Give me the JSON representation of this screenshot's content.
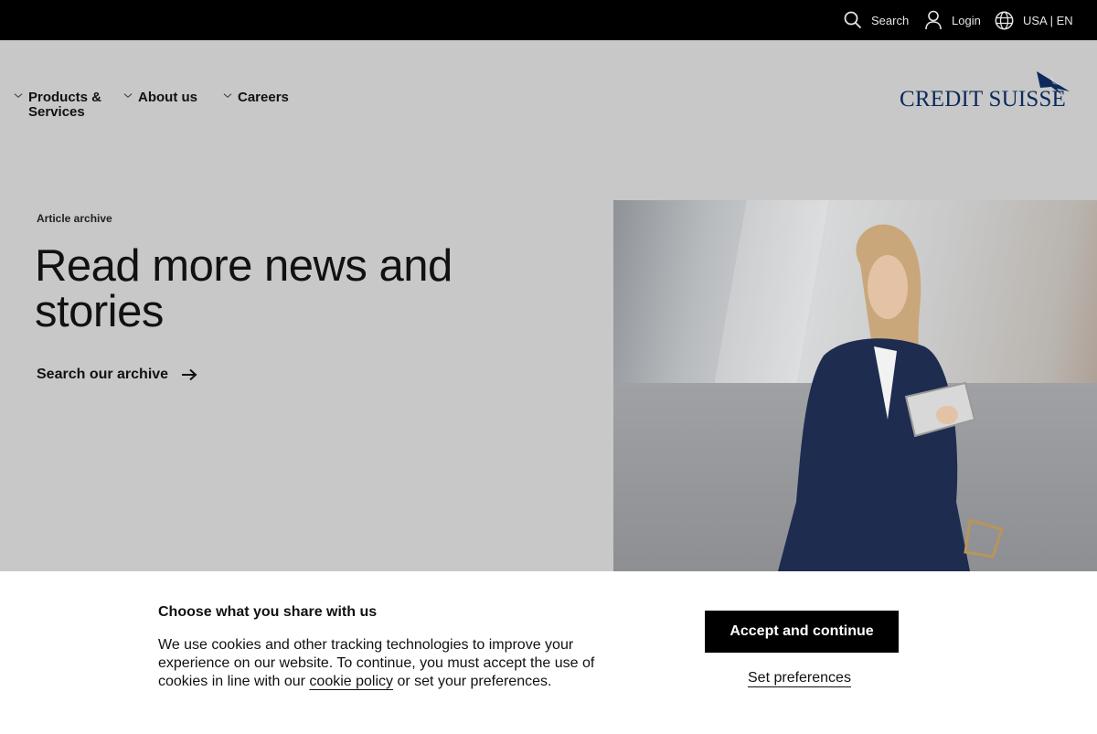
{
  "topbar": {
    "search_label": "Search",
    "login_label": "Login",
    "language_label": "USA | EN"
  },
  "nav": {
    "items": [
      {
        "label": "Products & Services"
      },
      {
        "label": "About us"
      },
      {
        "label": "Careers"
      }
    ]
  },
  "logo": {
    "text": "CREDIT SUISSE"
  },
  "hero": {
    "eyebrow": "Article archive",
    "headline": "Read more news and stories",
    "link_label": "Search our archive"
  },
  "cookie_banner": {
    "title": "Choose what you share with us",
    "text_before_link": "We use cookies and other tracking technologies to improve your experience on our website. To continue, you must accept the use of cookies in line with our ",
    "link_text": "cookie policy",
    "text_after_link": " or set your preferences.",
    "accept_label": "Accept and continue",
    "preferences_label": "Set preferences"
  },
  "colors": {
    "topbar_bg": "#000000",
    "page_bg": "#c8c8c8",
    "brand_blue": "#0b2a5b",
    "banner_bg": "#ffffff"
  },
  "icons": [
    "search-icon",
    "user-icon",
    "globe-icon",
    "chevron-down-icon",
    "arrow-right-icon",
    "sail-logo-icon"
  ]
}
